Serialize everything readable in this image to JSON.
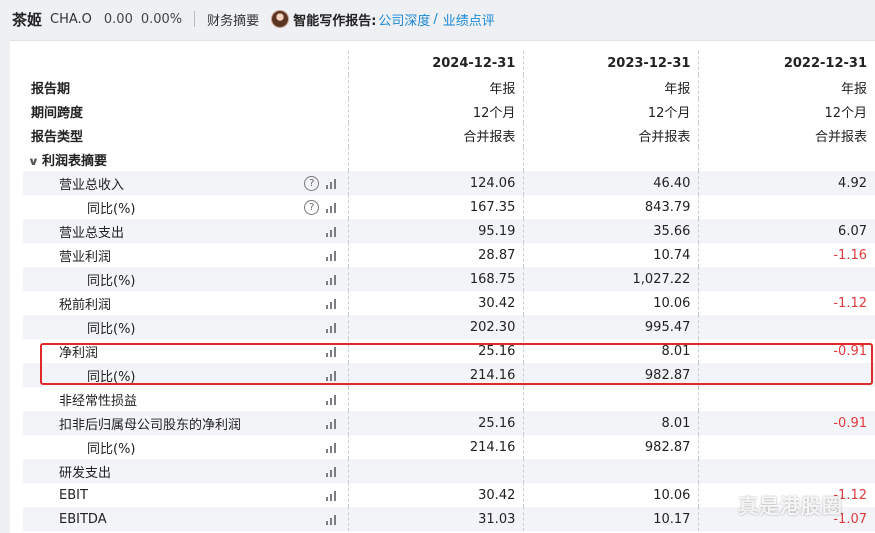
{
  "header": {
    "stock_name": "茶姬",
    "stock_code": "CHA.O",
    "price": "0.00",
    "change": "0.00%",
    "section": "财务摘要",
    "ai_label": "智能写作报告:",
    "ai_link1": "公司深度",
    "ai_sep": "/",
    "ai_link2": "业绩点评"
  },
  "table": {
    "columns": [
      "2024-12-31",
      "2023-12-31",
      "2022-12-31"
    ],
    "meta_rows": [
      {
        "label": "报告期",
        "values": [
          "年报",
          "年报",
          "年报"
        ]
      },
      {
        "label": "期间跨度",
        "values": [
          "12个月",
          "12个月",
          "12个月"
        ]
      },
      {
        "label": "报告类型",
        "values": [
          "合并报表",
          "合并报表",
          "合并报表"
        ]
      }
    ],
    "section_title": "利润表摘要",
    "rows": [
      {
        "label": "营业总收入",
        "level": 1,
        "help": "?",
        "values": [
          "124.06",
          "46.40",
          "4.92"
        ]
      },
      {
        "label": "同比(%)",
        "level": 2,
        "help": "?",
        "values": [
          "167.35",
          "843.79",
          ""
        ]
      },
      {
        "label": "营业总支出",
        "level": 1,
        "values": [
          "95.19",
          "35.66",
          "6.07"
        ]
      },
      {
        "label": "营业利润",
        "level": 1,
        "values": [
          "28.87",
          "10.74",
          "-1.16"
        ]
      },
      {
        "label": "同比(%)",
        "level": 2,
        "values": [
          "168.75",
          "1,027.22",
          ""
        ]
      },
      {
        "label": "税前利润",
        "level": 1,
        "values": [
          "30.42",
          "10.06",
          "-1.12"
        ]
      },
      {
        "label": "同比(%)",
        "level": 2,
        "values": [
          "202.30",
          "995.47",
          ""
        ]
      },
      {
        "label": "净利润",
        "level": 1,
        "values": [
          "25.16",
          "8.01",
          "-0.91"
        ]
      },
      {
        "label": "同比(%)",
        "level": 2,
        "values": [
          "214.16",
          "982.87",
          ""
        ]
      },
      {
        "label": "非经常性损益",
        "level": 1,
        "values": [
          "",
          "",
          ""
        ]
      },
      {
        "label": "扣非后归属母公司股东的净利润",
        "level": 1,
        "values": [
          "25.16",
          "8.01",
          "-0.91"
        ]
      },
      {
        "label": "同比(%)",
        "level": 2,
        "values": [
          "214.16",
          "982.87",
          ""
        ]
      },
      {
        "label": "研发支出",
        "level": 1,
        "values": [
          "",
          "",
          ""
        ]
      },
      {
        "label": "EBIT",
        "level": 1,
        "values": [
          "30.42",
          "10.06",
          "-1.12"
        ]
      },
      {
        "label": "EBITDA",
        "level": 1,
        "values": [
          "31.03",
          "10.17",
          "-1.07"
        ]
      }
    ]
  },
  "colors": {
    "negative": "#e03c3c",
    "link": "#1a88d6",
    "highlight_box": "#e02a2a"
  },
  "icons": {
    "chart": "bar-chart-icon",
    "help": "help-circle-icon",
    "collapse": "chevron-down-icon"
  },
  "watermark": "真是港股圈"
}
